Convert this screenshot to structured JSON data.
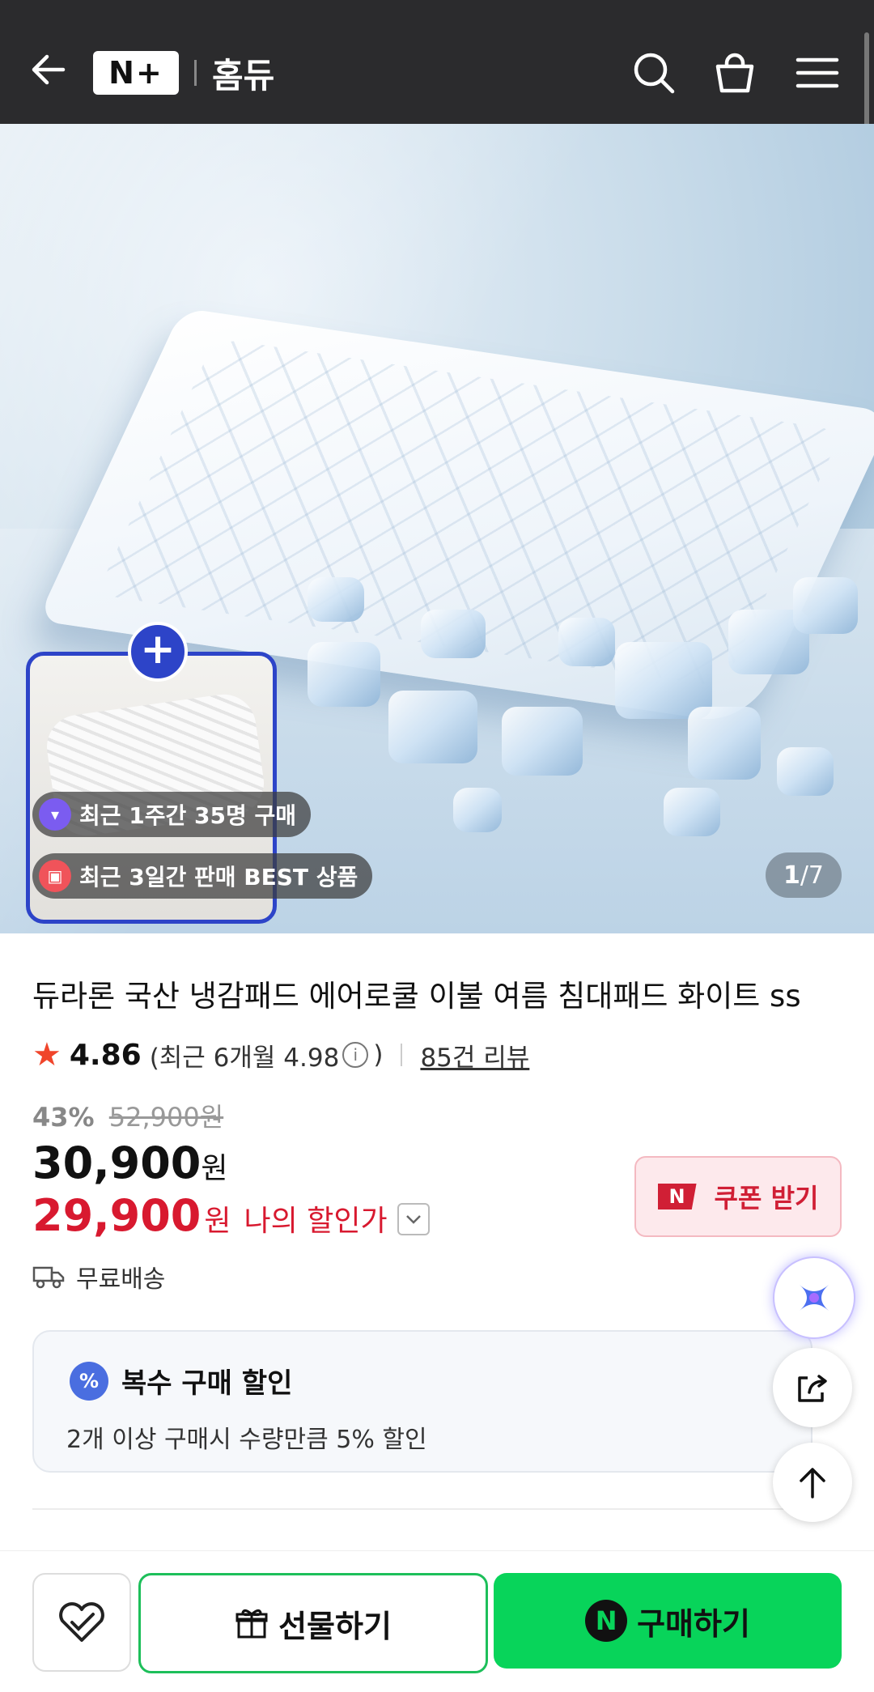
{
  "header": {
    "logo": "N+",
    "brand": "홈듀"
  },
  "gallery": {
    "counter_current": "1",
    "counter_total": "/7",
    "badges": [
      {
        "text": "최근 1주간 35명 구매",
        "color": "#7b5cf0"
      },
      {
        "text": "최근 3일간 판매 BEST 상품",
        "color": "#f0535a"
      }
    ]
  },
  "product": {
    "title": "듀라론 국산 냉감패드 에어로쿨 이불 여름 침대패드 화이트 ss",
    "rating": "4.86",
    "rating_recent": "(최근 6개월 4.98",
    "rating_info": "i",
    "rating_close": ")",
    "review_count": "85건 리뷰",
    "discount_rate": "43%",
    "original_price": "52,900원",
    "price": "30,900",
    "price_unit": "원",
    "my_price": "29,900",
    "my_price_unit": "원",
    "my_price_label": "나의 할인가",
    "coupon_label": "쿠폰 받기",
    "coupon_badge": "N",
    "shipping": "무료배송"
  },
  "multi_discount": {
    "badge": "%",
    "title": "복수 구매 할인",
    "desc": "2개 이상 구매시 수량만큼 5% 할인"
  },
  "bottom": {
    "gift_label": "선물하기",
    "buy_badge": "N",
    "buy_label": "구매하기"
  },
  "colors": {
    "header_bg": "#2b2b2d",
    "accent_blue": "#2d44c8",
    "price_red": "#d8192f",
    "buy_green": "#08d45a"
  }
}
